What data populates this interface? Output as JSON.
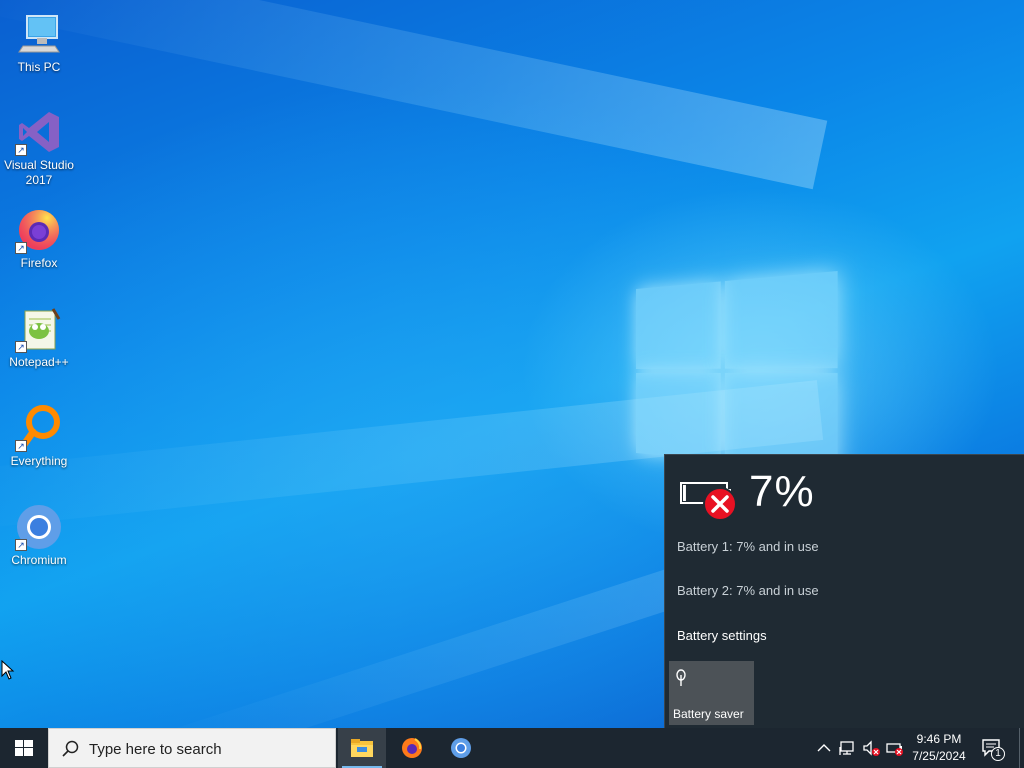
{
  "desktop": {
    "icons": [
      {
        "label_line1": "This PC",
        "label_line2": "",
        "icon": "pc-icon"
      },
      {
        "label_line1": "Visual Studio",
        "label_line2": "2017",
        "icon": "visual-studio-icon"
      },
      {
        "label_line1": "Firefox",
        "label_line2": "",
        "icon": "firefox-icon"
      },
      {
        "label_line1": "Notepad++",
        "label_line2": "",
        "icon": "notepadpp-icon"
      },
      {
        "label_line1": "Everything",
        "label_line2": "",
        "icon": "everything-icon"
      },
      {
        "label_line1": "Chromium",
        "label_line2": "",
        "icon": "chromium-icon"
      }
    ]
  },
  "battery_flyout": {
    "percent": "7%",
    "battery1": "Battery 1: 7% and in use",
    "battery2": "Battery 2: 7% and in use",
    "settings_link": "Battery settings",
    "saver_label": "Battery saver",
    "level": 0.07,
    "status_color": "#e81123"
  },
  "taskbar": {
    "search_placeholder": "Type here to search",
    "apps": [
      "file-explorer-icon",
      "firefox-icon",
      "chromium-icon"
    ],
    "clock_time": "9:46 PM",
    "clock_date": "7/25/2024",
    "notification_count": "1",
    "accent": "#76b9ed"
  }
}
